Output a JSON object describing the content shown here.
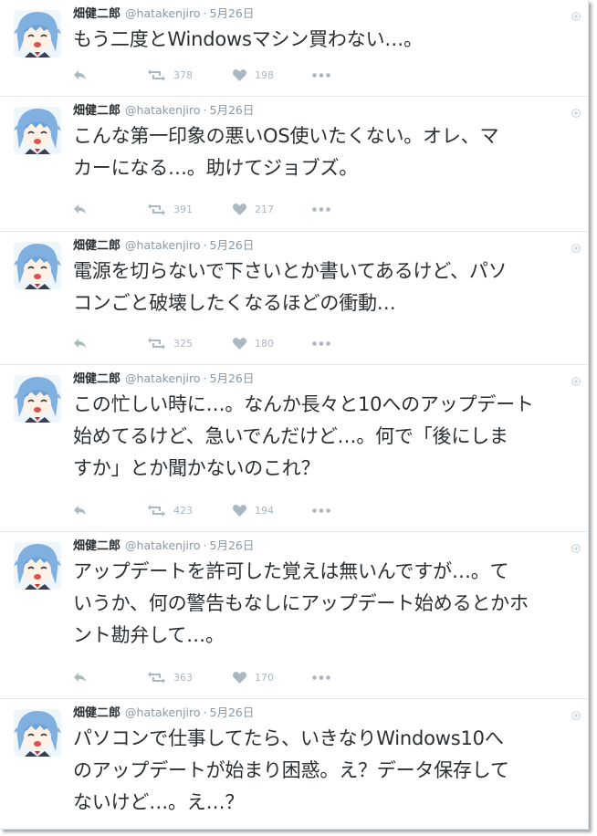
{
  "tweets": [
    {
      "display_name": "畑健二郎",
      "handle": "@hatakenjiro",
      "separator": "·",
      "date": "5月26日",
      "lines": [
        "もう二度とWindowsマシン買わない…。"
      ],
      "retweets": "378",
      "likes": "198"
    },
    {
      "display_name": "畑健二郎",
      "handle": "@hatakenjiro",
      "separator": "·",
      "date": "5月26日",
      "lines": [
        "こんな第一印象の悪いOS使いたくない。オレ、マ",
        "カーになる…。助けてジョブズ。"
      ],
      "retweets": "391",
      "likes": "217"
    },
    {
      "display_name": "畑健二郎",
      "handle": "@hatakenjiro",
      "separator": "·",
      "date": "5月26日",
      "lines": [
        "電源を切らないで下さいとか書いてあるけど、パソ",
        "コンごと破壊したくなるほどの衝動…"
      ],
      "retweets": "325",
      "likes": "180"
    },
    {
      "display_name": "畑健二郎",
      "handle": "@hatakenjiro",
      "separator": "·",
      "date": "5月26日",
      "lines": [
        "この忙しい時に…。なんか長々と10へのアップデート",
        "始めてるけど、急いでんだけど…。何で「後にしま",
        "すか」とか聞かないのこれ？"
      ],
      "retweets": "423",
      "likes": "194"
    },
    {
      "display_name": "畑健二郎",
      "handle": "@hatakenjiro",
      "separator": "·",
      "date": "5月26日",
      "lines": [
        "アップデートを許可した覚えは無いんですが…。て",
        "いうか、何の警告もなしにアップデート始めるとかホ",
        "ント勘弁して…。"
      ],
      "retweets": "363",
      "likes": "170"
    },
    {
      "display_name": "畑健二郎",
      "handle": "@hatakenjiro",
      "separator": "·",
      "date": "5月26日",
      "lines": [
        "パソコンで仕事してたら、いきなりWindows10へ",
        "のアップデートが始まり困惑。え？データ保存して",
        "ないけど…。え…？"
      ],
      "retweets": "",
      "likes": ""
    }
  ],
  "icons": {
    "reply": "reply-arrow-icon",
    "retweet": "retweet-icon",
    "like": "heart-icon",
    "more": "more-dots-icon",
    "corner": "globe-icon"
  },
  "colors": {
    "text": "#292f33",
    "meta": "#8899a6",
    "action": "#aab8c2",
    "border": "#e1e8ed"
  }
}
